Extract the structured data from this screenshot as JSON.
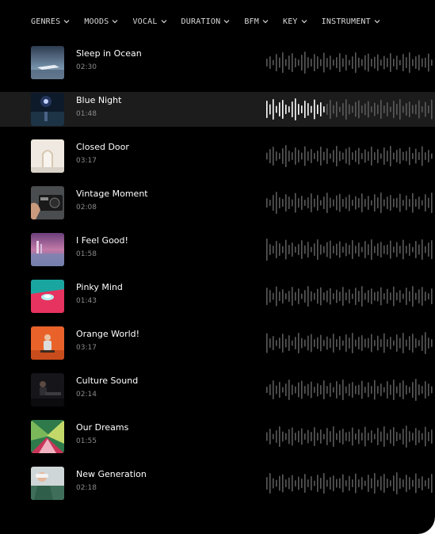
{
  "filters": [
    {
      "label": "GENRES",
      "icon": "chevron-down-icon"
    },
    {
      "label": "MOODS",
      "icon": "chevron-down-icon"
    },
    {
      "label": "VOCAL",
      "icon": "chevron-down-icon"
    },
    {
      "label": "DURATION",
      "icon": "chevron-down-icon"
    },
    {
      "label": "BFM",
      "icon": "chevron-down-icon"
    },
    {
      "label": "KEY",
      "icon": "chevron-down-icon"
    },
    {
      "label": "INSTRUMENT",
      "icon": "chevron-down-icon"
    }
  ],
  "tracks": [
    {
      "title": "Sleep in Ocean",
      "duration": "02:30",
      "progress": 0
    },
    {
      "title": "Blue Night",
      "duration": "01:48",
      "progress": 0.36
    },
    {
      "title": "Closed Door",
      "duration": "03:17",
      "progress": 0
    },
    {
      "title": "Vintage Moment",
      "duration": "02:08",
      "progress": 0
    },
    {
      "title": "I Feel Good!",
      "duration": "01:58",
      "progress": 0
    },
    {
      "title": "Pinky Mind",
      "duration": "01:43",
      "progress": 0
    },
    {
      "title": "Orange World!",
      "duration": "03:17",
      "progress": 0
    },
    {
      "title": "Culture Sound",
      "duration": "02:14",
      "progress": 0
    },
    {
      "title": "Our Dreams",
      "duration": "01:55",
      "progress": 0
    },
    {
      "title": "New Generation",
      "duration": "02:18",
      "progress": 0
    }
  ],
  "colors": {
    "background": "#000000",
    "active_row": "#1c1c1c",
    "waveform_played": "#ffffff",
    "waveform_unplayed": "#5a5a5a"
  }
}
